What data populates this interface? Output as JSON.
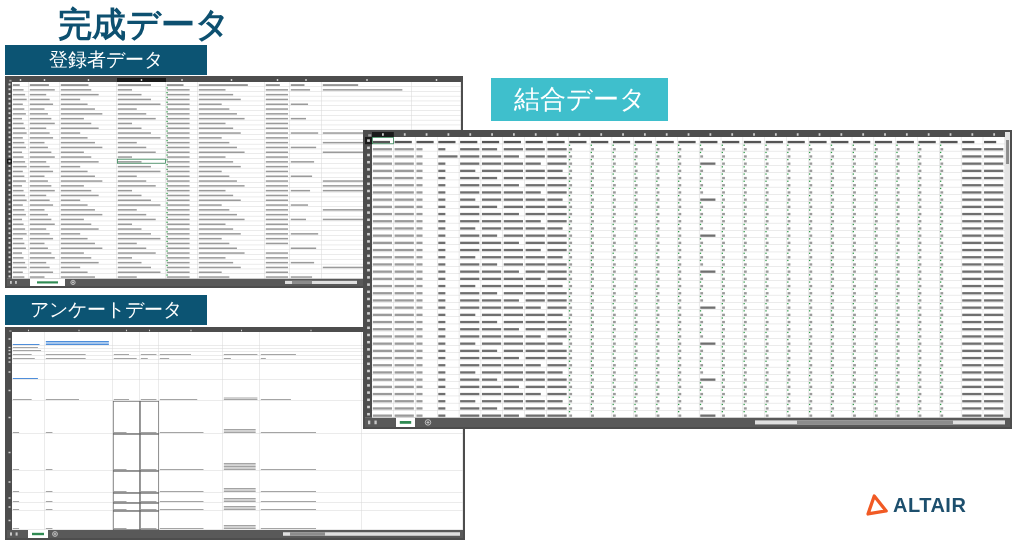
{
  "title": "完成データ",
  "sections": [
    {
      "label": "登録者データ",
      "kind": "dark"
    },
    {
      "label": "アンケートデータ",
      "kind": "dark"
    },
    {
      "label": "結合データ",
      "kind": "accent"
    }
  ],
  "logo": {
    "text": "ALTAIR"
  }
}
